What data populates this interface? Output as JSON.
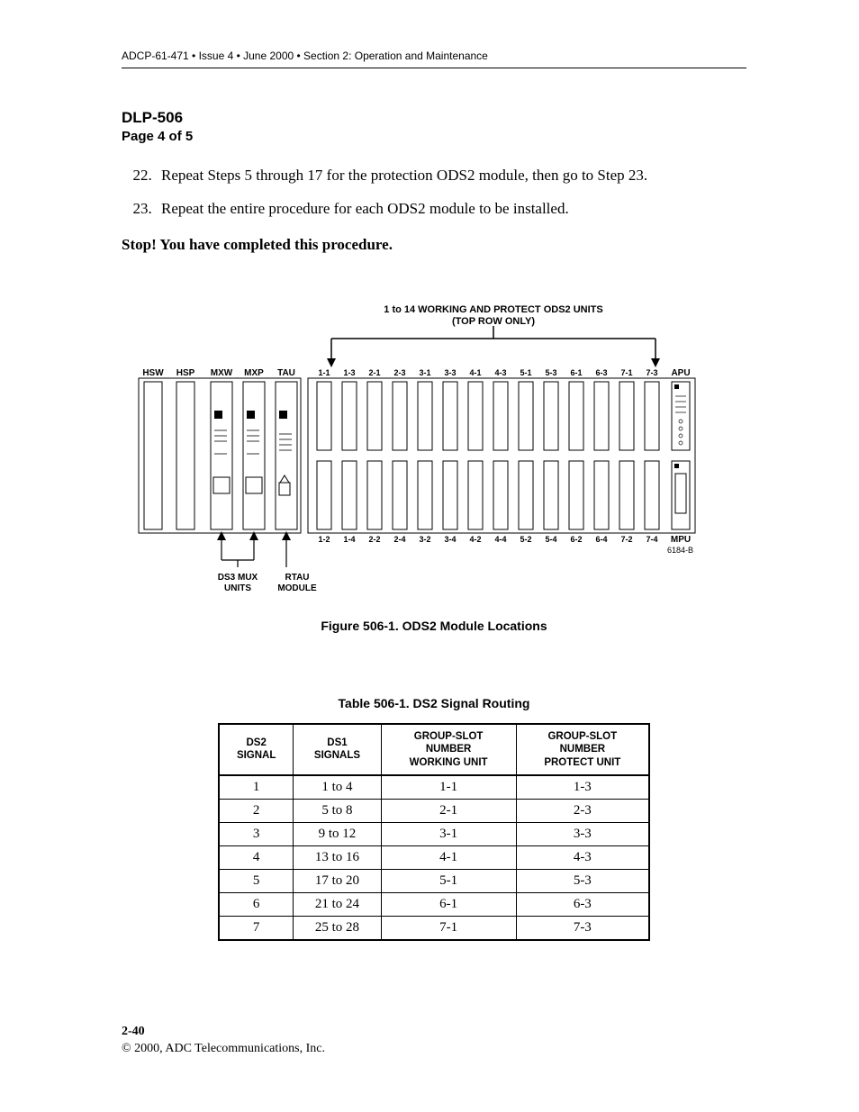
{
  "header": {
    "running_head": "ADCP-61-471 • Issue 4 • June 2000 • Section 2: Operation and Maintenance"
  },
  "proc": {
    "code": "DLP-506",
    "page_line": "Page 4 of 5"
  },
  "steps": [
    {
      "num": "22",
      "text": "Repeat Steps 5 through 17 for the protection ODS2 module, then go to Step 23."
    },
    {
      "num": "23",
      "text": "Repeat the entire procedure for each ODS2 module to be installed."
    }
  ],
  "stop_line": "Stop! You have completed this procedure.",
  "figure": {
    "caption": "Figure 506-1. ODS2 Module Locations",
    "top_note_l1": "1 to 14 WORKING AND PROTECT ODS2 UNITS",
    "top_note_l2": "(TOP ROW ONLY)",
    "drawing_id": "6184-B",
    "left_label_l1": "DS3 MUX",
    "left_label_l2": "UNITS",
    "right_label_l1": "RTAU",
    "right_label_l2": "MODULE",
    "left_slots": [
      "HSW",
      "HSP",
      "MXW",
      "MXP",
      "TAU"
    ],
    "right_slots": {
      "top": "APU",
      "bottom": "MPU"
    },
    "cols_top": [
      "1-1",
      "1-3",
      "2-1",
      "2-3",
      "3-1",
      "3-3",
      "4-1",
      "4-3",
      "5-1",
      "5-3",
      "6-1",
      "6-3",
      "7-1",
      "7-3"
    ],
    "cols_bottom": [
      "1-2",
      "1-4",
      "2-2",
      "2-4",
      "3-2",
      "3-4",
      "4-2",
      "4-4",
      "5-2",
      "5-4",
      "6-2",
      "6-4",
      "7-2",
      "7-4"
    ]
  },
  "table": {
    "caption": "Table 506-1. DS2 Signal Routing",
    "headers": {
      "c0_l1": "DS2",
      "c0_l2": "SIGNAL",
      "c1_l1": "DS1",
      "c1_l2": "SIGNALS",
      "c2_l1": "GROUP-SLOT",
      "c2_l2": "NUMBER",
      "c2_l3": "WORKING UNIT",
      "c3_l1": "GROUP-SLOT",
      "c3_l2": "NUMBER",
      "c3_l3": "PROTECT UNIT"
    },
    "rows": [
      {
        "ds2": "1",
        "ds1": "1 to 4",
        "work": "1-1",
        "prot": "1-3"
      },
      {
        "ds2": "2",
        "ds1": "5 to 8",
        "work": "2-1",
        "prot": "2-3"
      },
      {
        "ds2": "3",
        "ds1": "9 to 12",
        "work": "3-1",
        "prot": "3-3"
      },
      {
        "ds2": "4",
        "ds1": "13 to 16",
        "work": "4-1",
        "prot": "4-3"
      },
      {
        "ds2": "5",
        "ds1": "17 to 20",
        "work": "5-1",
        "prot": "5-3"
      },
      {
        "ds2": "6",
        "ds1": "21 to 24",
        "work": "6-1",
        "prot": "6-3"
      },
      {
        "ds2": "7",
        "ds1": "25 to 28",
        "work": "7-1",
        "prot": "7-3"
      }
    ]
  },
  "footer": {
    "page_num": "2-40",
    "copyright": "© 2000, ADC Telecommunications, Inc."
  },
  "chart_data": {
    "type": "table",
    "title": "Table 506-1. DS2 Signal Routing",
    "columns": [
      "DS2 SIGNAL",
      "DS1 SIGNALS",
      "GROUP-SLOT NUMBER WORKING UNIT",
      "GROUP-SLOT NUMBER PROTECT UNIT"
    ],
    "rows": [
      [
        "1",
        "1 to 4",
        "1-1",
        "1-3"
      ],
      [
        "2",
        "5 to 8",
        "2-1",
        "2-3"
      ],
      [
        "3",
        "9 to 12",
        "3-1",
        "3-3"
      ],
      [
        "4",
        "13 to 16",
        "4-1",
        "4-3"
      ],
      [
        "5",
        "17 to 20",
        "5-1",
        "5-3"
      ],
      [
        "6",
        "21 to 24",
        "6-1",
        "6-3"
      ],
      [
        "7",
        "25 to 28",
        "7-1",
        "7-3"
      ]
    ]
  }
}
